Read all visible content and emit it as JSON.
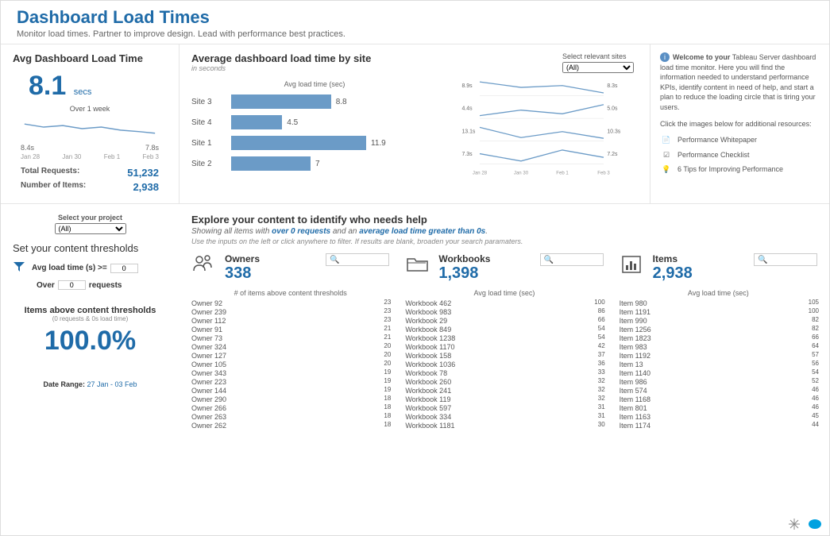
{
  "header": {
    "title": "Dashboard Load Times",
    "subtitle": "Monitor load times. Partner to improve design. Lead with performance best practices."
  },
  "avg_card": {
    "title": "Avg Dashboard Load Time",
    "value": "8.1",
    "unit": "secs",
    "period_label": "Over 1 week",
    "spark_start": "8.4s",
    "spark_end": "7.8s",
    "axis": [
      "Jan 28",
      "Jan 30",
      "Feb 1",
      "Feb 3"
    ],
    "total_requests_label": "Total Requests:",
    "total_requests_value": "51,232",
    "num_items_label": "Number of Items:",
    "num_items_value": "2,938"
  },
  "site_card": {
    "title": "Average dashboard load time by site",
    "subtitle": "in seconds",
    "bar_axis_label": "Avg load time (sec)",
    "filter_label": "Select relevant sites",
    "filter_value": "(All)",
    "multiline_axis": [
      "Jan 28",
      "Jan 30",
      "Feb 1",
      "Feb 3"
    ]
  },
  "welcome": {
    "intro_bold": "Welcome to your",
    "intro": " Tableau Server dashboard load time monitor. Here you will find the information needed to understand performance KPIs, identify content in need of help, and start a plan to reduce the loading circle that is tiring your users.",
    "click_label": "Click the images below for additional resources:",
    "r1": "Performance Whitepaper",
    "r2": "Performance Checklist",
    "r3": "6 Tips for Improving Performance"
  },
  "filters": {
    "project_label": "Select your project",
    "project_value": "(All)",
    "thresh_title": "Set your content thresholds",
    "load_label_pre": "Avg load time (s) >=",
    "load_value": "0",
    "over_label": "Over",
    "over_value": "0",
    "requests_label": "requests",
    "above_title": "Items above content thresholds",
    "above_sub": "(0 requests & 0s load time)",
    "above_pct": "100.0%",
    "date_label": "Date Range:",
    "date_value": "27 Jan - 03 Feb"
  },
  "explore": {
    "title": "Explore your content to identify who needs help",
    "sub_pre": "Showing all items with",
    "sub_hl1": "over 0 requests",
    "sub_mid": "and an",
    "sub_hl2": "average load time greater than 0s",
    "sub2": "Use the inputs on the left or click anywhere to filter. If results are blank, broaden your search paramaters.",
    "owners_label": "Owners",
    "owners_count": "338",
    "owners_axis": "# of items above content thresholds",
    "workbooks_label": "Workbooks",
    "workbooks_count": "1,398",
    "workbooks_axis": "Avg load time (sec)",
    "items_label": "Items",
    "items_count": "2,938",
    "items_axis": "Avg load time (sec)"
  },
  "chart_data": {
    "site_bars": {
      "type": "bar",
      "categories": [
        "Site 3",
        "Site 4",
        "Site 1",
        "Site 2"
      ],
      "values": [
        8.8,
        4.5,
        11.9,
        7.0
      ],
      "xlabel": "Avg load time (sec)"
    },
    "site_lines": {
      "type": "line",
      "x": [
        "Jan 28",
        "Jan 30",
        "Feb 1",
        "Feb 3"
      ],
      "series": [
        {
          "name": "Site 3",
          "start_label": "8.9s",
          "end_label": "8.3s",
          "values": [
            8.9,
            8.6,
            8.7,
            8.3
          ]
        },
        {
          "name": "Site 4",
          "start_label": "4.4s",
          "end_label": "5.0s",
          "values": [
            4.4,
            4.7,
            4.5,
            5.0
          ]
        },
        {
          "name": "Site 1",
          "start_label": "13.1s",
          "end_label": "10.3s",
          "values": [
            13.1,
            10.5,
            12.0,
            10.3
          ]
        },
        {
          "name": "Site 2",
          "start_label": "7.3s",
          "end_label": "7.2s",
          "values": [
            7.3,
            7.1,
            7.4,
            7.2
          ]
        }
      ]
    },
    "avg_sparkline": {
      "type": "line",
      "x": [
        "Jan 28",
        "Jan 30",
        "Feb 1",
        "Feb 3"
      ],
      "values": [
        8.4,
        8.2,
        8.3,
        8.0,
        8.1,
        7.9,
        7.8
      ]
    },
    "owners": {
      "type": "bar",
      "max": 23,
      "rows": [
        {
          "label": "Owner 92",
          "value": 23
        },
        {
          "label": "Owner 239",
          "value": 23
        },
        {
          "label": "Owner 112",
          "value": 23
        },
        {
          "label": "Owner 91",
          "value": 21
        },
        {
          "label": "Owner 73",
          "value": 21
        },
        {
          "label": "Owner 324",
          "value": 20
        },
        {
          "label": "Owner 127",
          "value": 20
        },
        {
          "label": "Owner 105",
          "value": 20
        },
        {
          "label": "Owner 343",
          "value": 19
        },
        {
          "label": "Owner 223",
          "value": 19
        },
        {
          "label": "Owner 144",
          "value": 19
        },
        {
          "label": "Owner 290",
          "value": 18
        },
        {
          "label": "Owner 266",
          "value": 18
        },
        {
          "label": "Owner 263",
          "value": 18
        },
        {
          "label": "Owner 262",
          "value": 18
        }
      ]
    },
    "workbooks": {
      "type": "bar",
      "max": 100,
      "rows": [
        {
          "label": "Workbook 462",
          "value": 100
        },
        {
          "label": "Workbook 983",
          "value": 86
        },
        {
          "label": "Workbook 29",
          "value": 66
        },
        {
          "label": "Workbook 849",
          "value": 54
        },
        {
          "label": "Workbook 1238",
          "value": 54
        },
        {
          "label": "Workbook 1170",
          "value": 42
        },
        {
          "label": "Workbook 158",
          "value": 37
        },
        {
          "label": "Workbook 1036",
          "value": 36
        },
        {
          "label": "Workbook 78",
          "value": 33
        },
        {
          "label": "Workbook 260",
          "value": 32
        },
        {
          "label": "Workbook 241",
          "value": 32
        },
        {
          "label": "Workbook 119",
          "value": 32
        },
        {
          "label": "Workbook 597",
          "value": 31
        },
        {
          "label": "Workbook 334",
          "value": 31
        },
        {
          "label": "Workbook 1181",
          "value": 30
        }
      ]
    },
    "items": {
      "type": "bar",
      "max": 105,
      "rows": [
        {
          "label": "Item 980",
          "value": 105
        },
        {
          "label": "Item 1191",
          "value": 100
        },
        {
          "label": "Item 990",
          "value": 82
        },
        {
          "label": "Item 1256",
          "value": 82
        },
        {
          "label": "Item 1823",
          "value": 66
        },
        {
          "label": "Item 983",
          "value": 64
        },
        {
          "label": "Item 1192",
          "value": 57
        },
        {
          "label": "Item 13",
          "value": 56
        },
        {
          "label": "Item 1140",
          "value": 54
        },
        {
          "label": "Item 986",
          "value": 52
        },
        {
          "label": "Item 574",
          "value": 46
        },
        {
          "label": "Item 1168",
          "value": 46
        },
        {
          "label": "Item 801",
          "value": 46
        },
        {
          "label": "Item 1163",
          "value": 45
        },
        {
          "label": "Item 1174",
          "value": 44
        }
      ]
    }
  }
}
